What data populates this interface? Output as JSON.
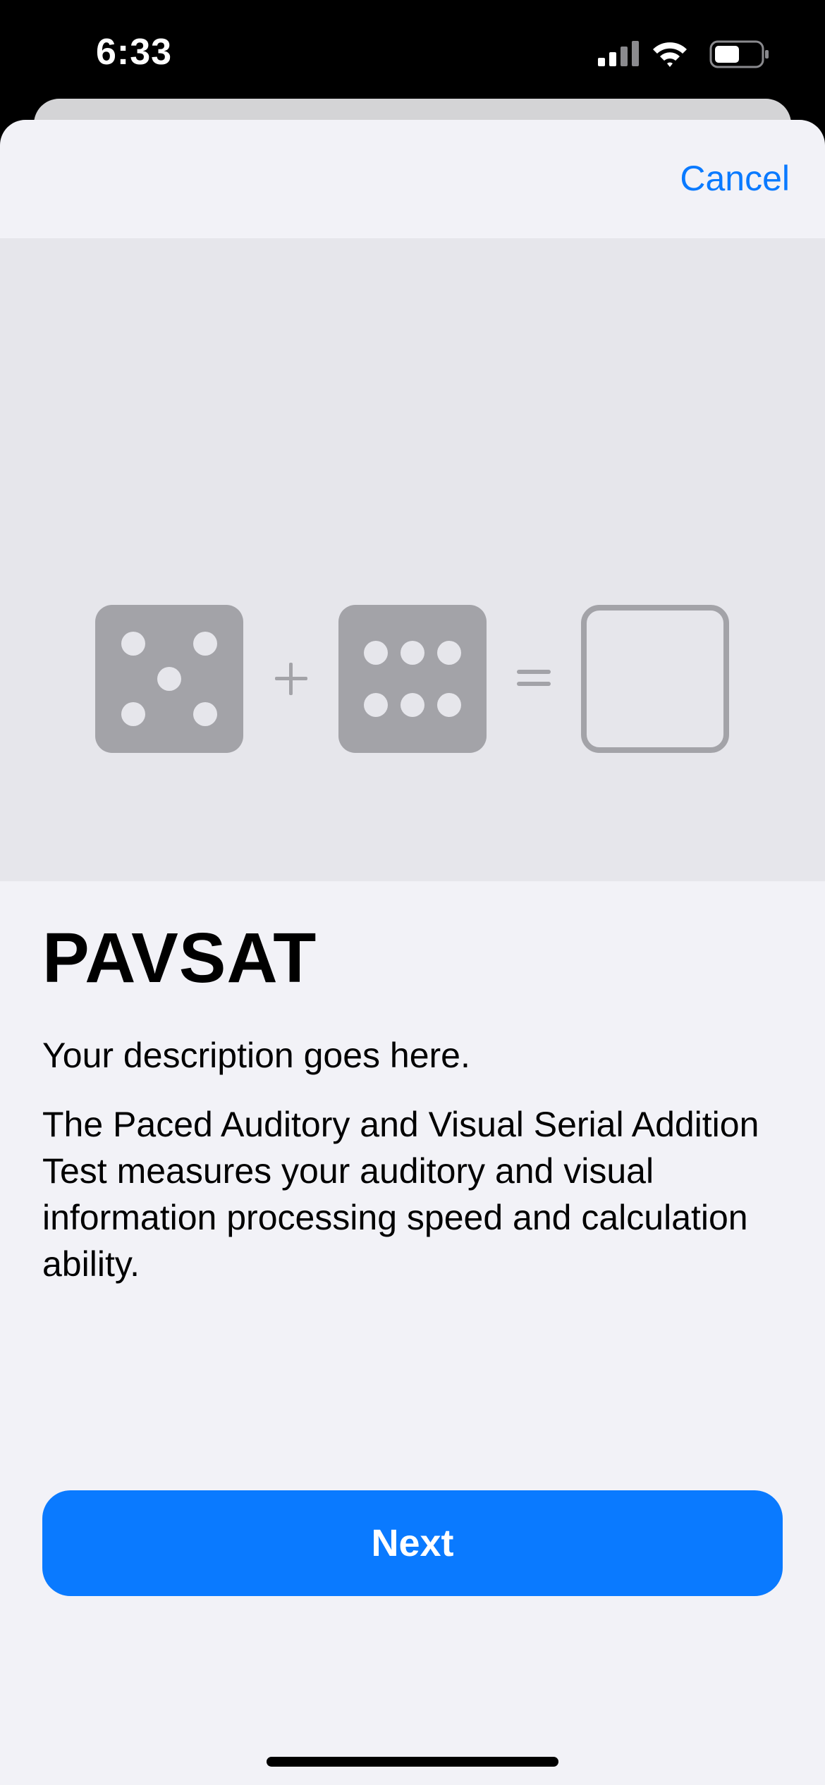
{
  "status_bar": {
    "time": "6:33",
    "icons": [
      "signal-icon",
      "wifi-icon",
      "battery-icon"
    ]
  },
  "nav": {
    "cancel_label": "Cancel"
  },
  "illustration": {
    "left_die_pips": 5,
    "right_die_pips": 6,
    "plus_symbol": "+",
    "equals_symbol": "=",
    "die_color": "#a3a3a8",
    "background_color": "#e6e6eb"
  },
  "content": {
    "title": "PAVSAT",
    "description": "Your description goes here.",
    "body": "The Paced Auditory and Visual Serial Addition Test measures your auditory and visual information processing speed and calculation ability."
  },
  "actions": {
    "next_label": "Next"
  },
  "colors": {
    "accent": "#0a7aff",
    "sheet_background": "#f2f2f7"
  }
}
